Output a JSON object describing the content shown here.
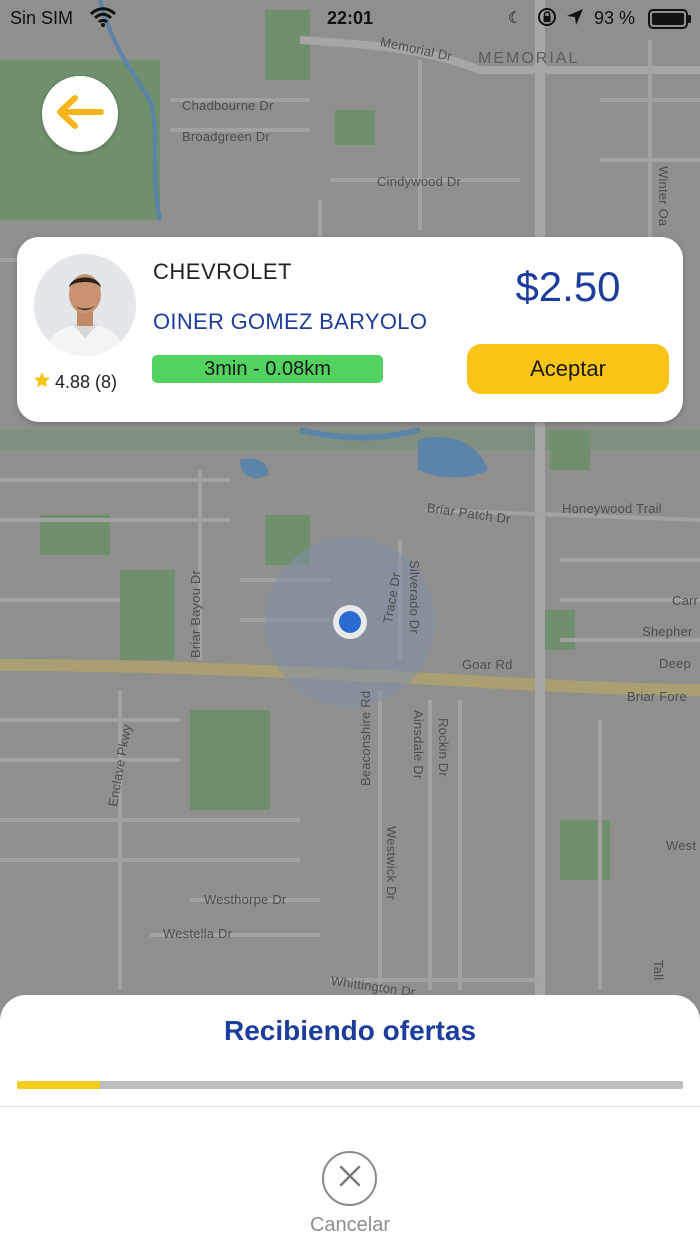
{
  "status_bar": {
    "carrier": "Sin SIM",
    "time": "22:01",
    "battery_percent": "93 %",
    "icons": [
      "wifi-icon",
      "moon-icon",
      "rotation-lock-icon",
      "location-arrow-icon",
      "battery-icon"
    ]
  },
  "map": {
    "labels": {
      "memorial_dr": "Memorial Dr",
      "memorial": "MEMORIAL",
      "chadbourne": "Chadbourne Dr",
      "broadgreen": "Broadgreen Dr",
      "cindywood": "Cindywood Dr",
      "winter_oak": "Winter Oa",
      "briar_patch": "Briar Patch Dr",
      "honeywood": "Honeywood Trail",
      "briar_bayou": "Briar Bayou Dr",
      "trace": "Trace Dr",
      "silverado": "Silverado Dr",
      "goar": "Goar Rd",
      "briar_forest": "Briar Fore",
      "carr": "Carr",
      "shepherd": "Shepher",
      "deep": "Deep",
      "enclave": "Enclave Pkwy",
      "beaconshire": "Beaconshire Rd",
      "ainsdale": "Ainsdale Dr",
      "rockin": "Rockin Dr",
      "westwick": "Westwick Dr",
      "westhorpe": "Westhorpe Dr",
      "westella": "Westella Dr",
      "whittington": "Whittington Dr",
      "west": "West",
      "tall": "Tall"
    }
  },
  "back_button": {
    "icon": "arrow-left-icon",
    "color": "#f4b41a"
  },
  "offer": {
    "vehicle_brand": "CHEVROLET",
    "driver_name": "OINER GOMEZ BARYOLO",
    "rating": "4.88 (8)",
    "eta": "3min - 0.08km",
    "price": "$2.50",
    "accept_label": "Aceptar"
  },
  "bottom_sheet": {
    "title": "Recibiendo ofertas",
    "progress": 0.125,
    "cancel_label": "Cancelar"
  },
  "colors": {
    "brand_blue": "#1d3d9c",
    "accent_yellow": "#f8c517",
    "eta_green": "#52d35f"
  }
}
